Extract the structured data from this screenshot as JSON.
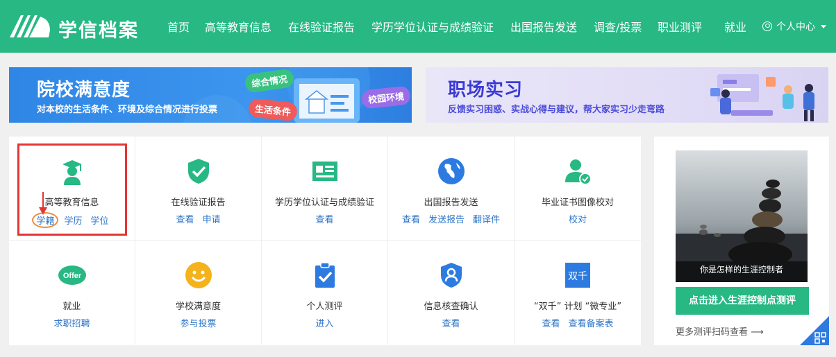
{
  "header": {
    "brand": "学信档案",
    "nav": [
      "首页",
      "高等教育信息",
      "在线验证报告",
      "学历学位认证与成绩验证",
      "出国报告发送",
      "调查/投票",
      "职业测评",
      "就业"
    ],
    "user_menu": "个人中心",
    "colors": {
      "primary": "#27b884"
    }
  },
  "banners": [
    {
      "title": "院校满意度",
      "subtitle": "对本校的生活条件、环境及综合情况进行投票",
      "tags": [
        "综合情况",
        "生活条件",
        "校园环境"
      ]
    },
    {
      "title": "职场实习",
      "subtitle": "反馈实习困惑、实战心得与建议，帮大家实习少走弯路"
    }
  ],
  "services": [
    {
      "icon": "graduate-icon",
      "title": "高等教育信息",
      "links": [
        "学籍",
        "学历",
        "学位"
      ]
    },
    {
      "icon": "shield-check-icon",
      "title": "在线验证报告",
      "links": [
        "查看",
        "申请"
      ]
    },
    {
      "icon": "id-card-icon",
      "title": "学历学位认证与成绩验证",
      "links": [
        "查看"
      ]
    },
    {
      "icon": "globe-icon",
      "title": "出国报告发送",
      "links": [
        "查看",
        "发送报告",
        "翻译件"
      ]
    },
    {
      "icon": "user-check-icon",
      "title": "毕业证书图像校对",
      "links": [
        "校对"
      ]
    },
    {
      "icon": "offer-icon",
      "title": "就业",
      "links": [
        "求职招聘"
      ]
    },
    {
      "icon": "smile-icon",
      "title": "学校满意度",
      "links": [
        "参与投票"
      ]
    },
    {
      "icon": "clipboard-check-icon",
      "title": "个人测评",
      "links": [
        "进入"
      ]
    },
    {
      "icon": "user-shield-icon",
      "title": "信息核查确认",
      "links": [
        "查看"
      ]
    },
    {
      "icon": "shuangqian-icon",
      "title": "“双千” 计划 “微专业”",
      "links": [
        "查看",
        "查看备案表"
      ]
    }
  ],
  "icon_labels": {
    "offer": "Offer",
    "shuangqian": "双千"
  },
  "side": {
    "photo_caption": "你是怎样的生涯控制者",
    "button": "点击进入生涯控制点测评",
    "more": "更多测评扫码查看 ⟶"
  }
}
